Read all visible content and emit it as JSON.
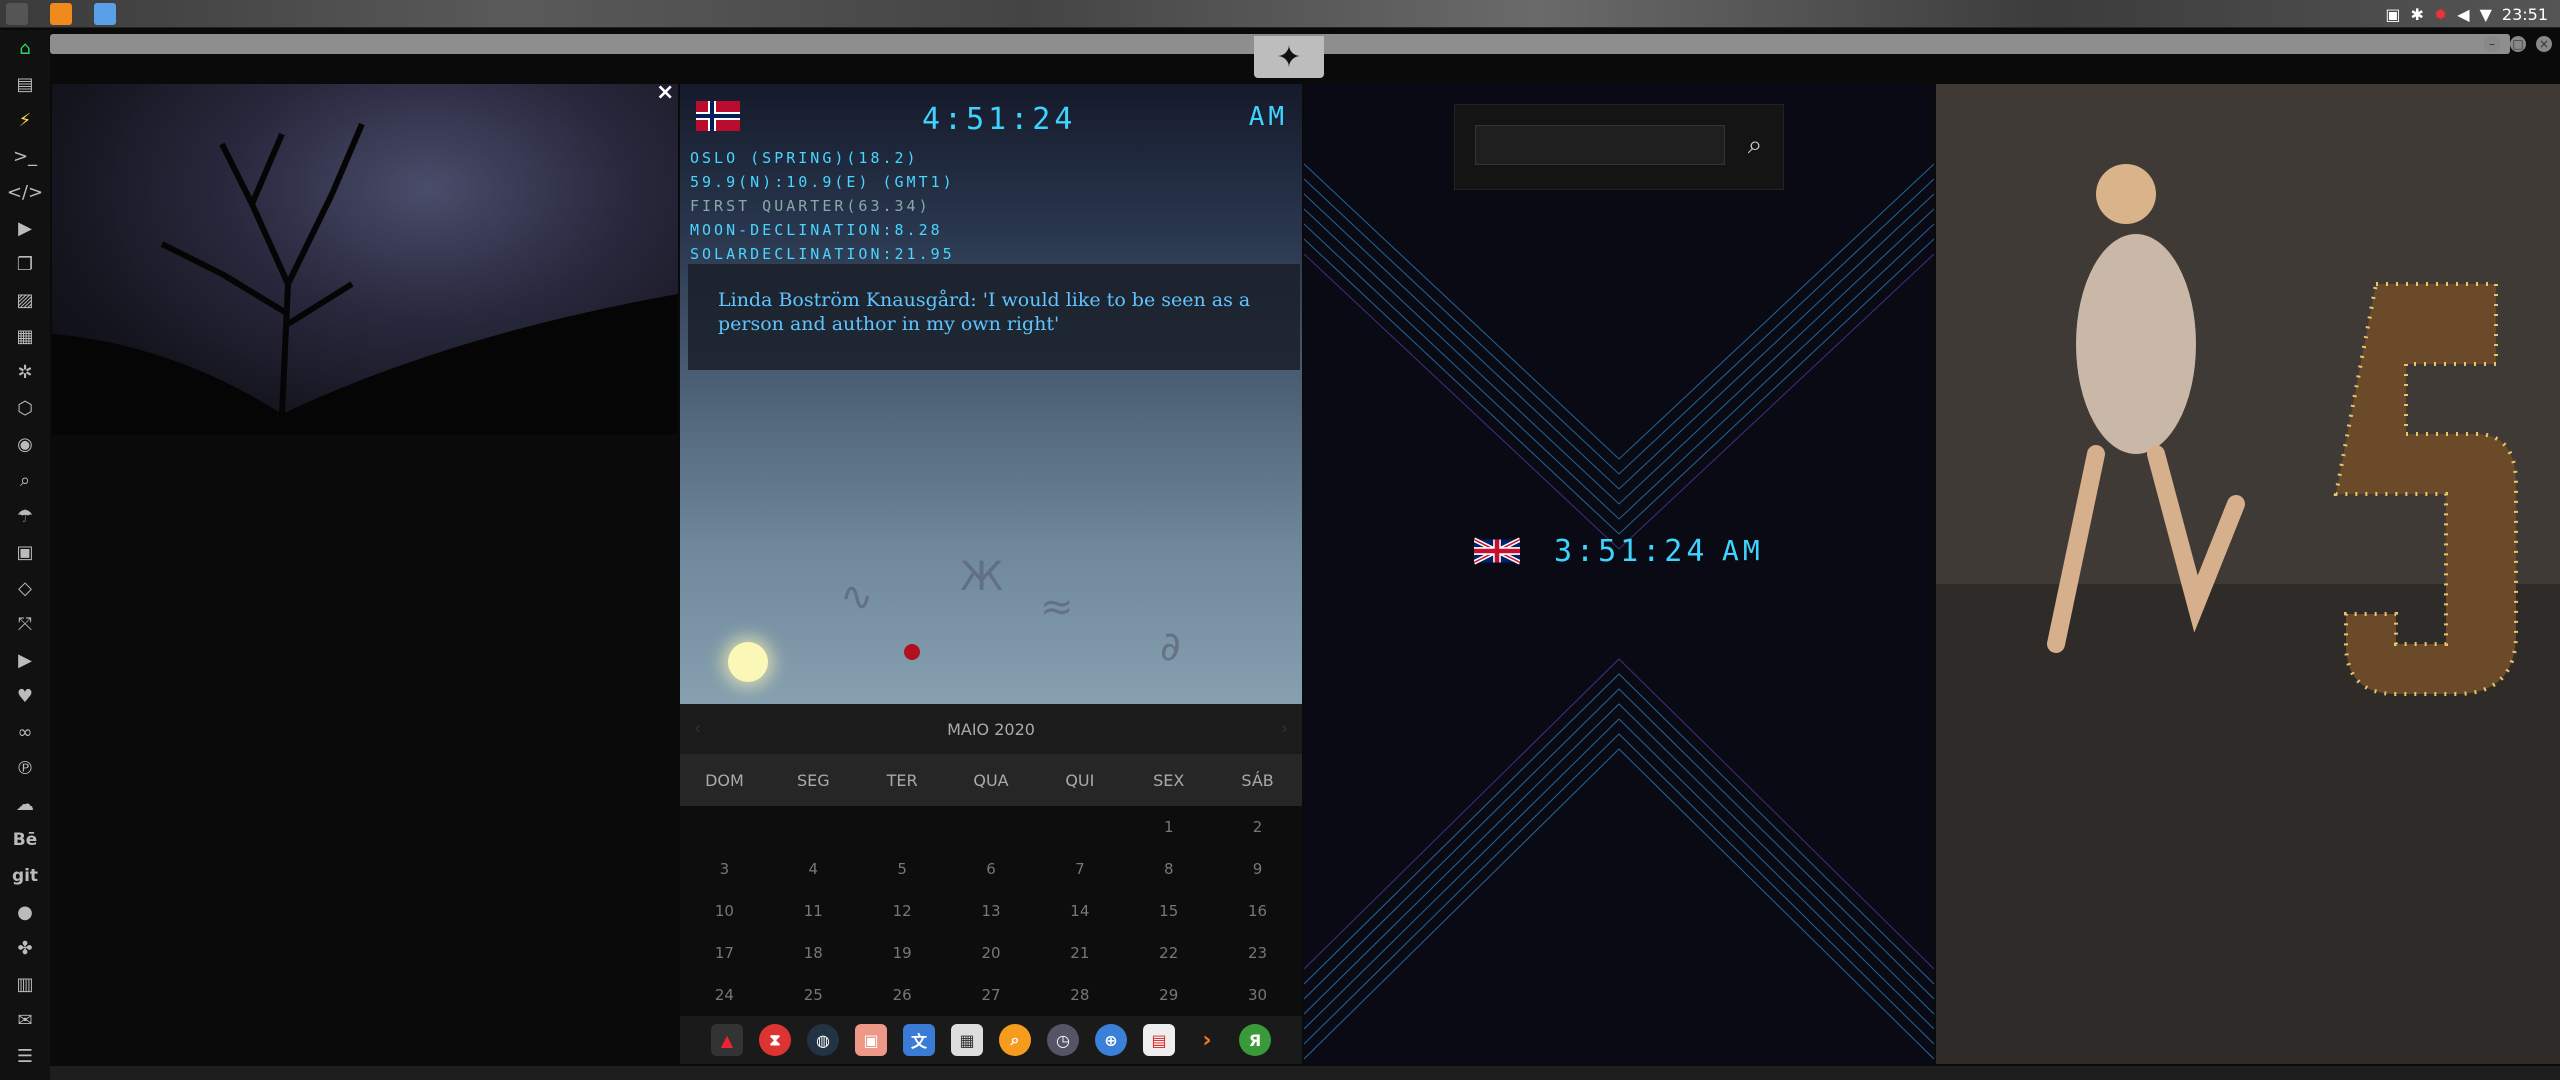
{
  "system_bar": {
    "clock": "23:51"
  },
  "oslo_widget": {
    "time": "4:51:24",
    "ampm": "AM",
    "info_lines": [
      "OSLO (SPRING)(18.2)",
      "59.9(N):10.9(E) (GMT1)",
      "FIRST QUARTER(63.34)",
      "MOON-DECLINATION:8.28",
      "SOLARDECLINATION:21.95"
    ]
  },
  "news": {
    "headline": "Linda Boström Knausgård: 'I would like to be seen as a person and author in my own right'"
  },
  "calendar": {
    "month_label": "MAIO 2020",
    "weekdays": [
      "DOM",
      "SEG",
      "TER",
      "QUA",
      "QUI",
      "SEX",
      "SÁB"
    ],
    "weeks": [
      [
        "",
        "",
        "",
        "",
        "",
        "1",
        "2"
      ],
      [
        "3",
        "4",
        "5",
        "6",
        "7",
        "8",
        "9"
      ],
      [
        "10",
        "11",
        "12",
        "13",
        "14",
        "15",
        "16"
      ],
      [
        "17",
        "18",
        "19",
        "20",
        "21",
        "22",
        "23"
      ],
      [
        "24",
        "25",
        "26",
        "27",
        "28",
        "29",
        "30"
      ]
    ]
  },
  "uk_widget": {
    "time": "3:51:24",
    "ampm": "AM"
  },
  "sidebar": {
    "text_items": [
      "Bē",
      "git"
    ]
  },
  "colors": {
    "accent_cyan": "#3ed4ff",
    "active_green": "#2fd26b"
  }
}
